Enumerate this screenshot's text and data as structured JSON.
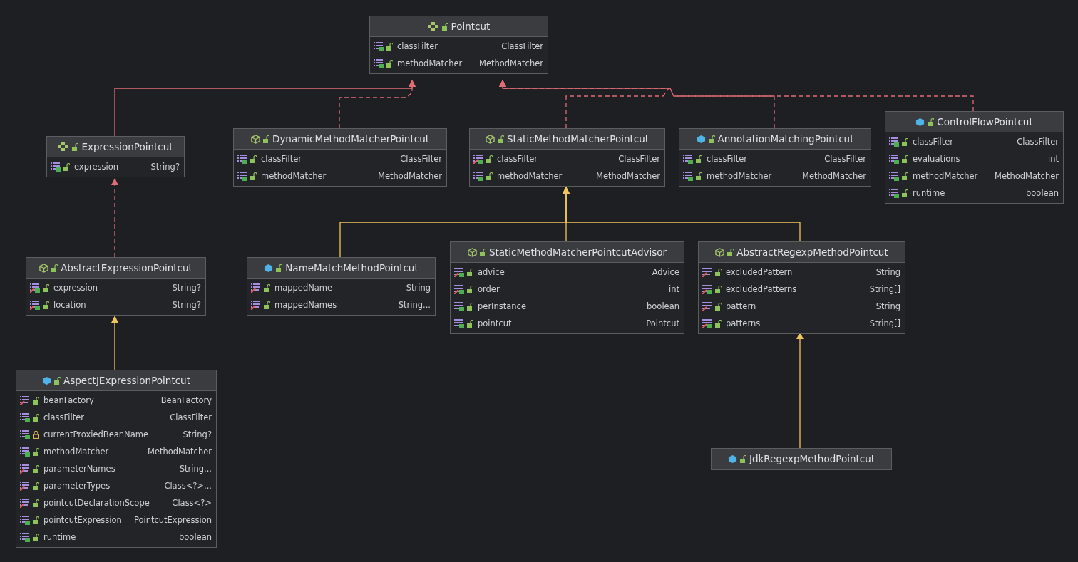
{
  "diagram": {
    "nodes": [
      {
        "name": "Pointcut",
        "kind": "interface",
        "fields": [
          {
            "name": "classFilter",
            "type": "ClassFilter",
            "readable": true,
            "writable": false,
            "private": false
          },
          {
            "name": "methodMatcher",
            "type": "MethodMatcher",
            "readable": true,
            "writable": false,
            "private": false
          }
        ]
      },
      {
        "name": "ExpressionPointcut",
        "kind": "interface",
        "fields": [
          {
            "name": "expression",
            "type": "String?",
            "readable": true,
            "writable": false,
            "private": false
          }
        ]
      },
      {
        "name": "DynamicMethodMatcherPointcut",
        "kind": "abstract",
        "fields": [
          {
            "name": "classFilter",
            "type": "ClassFilter",
            "readable": true,
            "writable": false,
            "private": false
          },
          {
            "name": "methodMatcher",
            "type": "MethodMatcher",
            "readable": true,
            "writable": false,
            "private": false
          }
        ]
      },
      {
        "name": "StaticMethodMatcherPointcut",
        "kind": "abstract",
        "fields": [
          {
            "name": "classFilter",
            "type": "ClassFilter",
            "readable": true,
            "writable": true,
            "private": false
          },
          {
            "name": "methodMatcher",
            "type": "MethodMatcher",
            "readable": true,
            "writable": false,
            "private": false
          }
        ]
      },
      {
        "name": "AnnotationMatchingPointcut",
        "kind": "class",
        "fields": [
          {
            "name": "classFilter",
            "type": "ClassFilter",
            "readable": true,
            "writable": false,
            "private": false
          },
          {
            "name": "methodMatcher",
            "type": "MethodMatcher",
            "readable": true,
            "writable": false,
            "private": false
          }
        ]
      },
      {
        "name": "ControlFlowPointcut",
        "kind": "class",
        "fields": [
          {
            "name": "classFilter",
            "type": "ClassFilter",
            "readable": true,
            "writable": false,
            "private": false
          },
          {
            "name": "evaluations",
            "type": "int",
            "readable": true,
            "writable": false,
            "private": false
          },
          {
            "name": "methodMatcher",
            "type": "MethodMatcher",
            "readable": true,
            "writable": false,
            "private": false
          },
          {
            "name": "runtime",
            "type": "boolean",
            "readable": true,
            "writable": false,
            "private": false
          }
        ]
      },
      {
        "name": "AbstractExpressionPointcut",
        "kind": "abstract",
        "fields": [
          {
            "name": "expression",
            "type": "String?",
            "readable": true,
            "writable": true,
            "private": false
          },
          {
            "name": "location",
            "type": "String?",
            "readable": true,
            "writable": true,
            "private": false
          }
        ]
      },
      {
        "name": "NameMatchMethodPointcut",
        "kind": "class",
        "fields": [
          {
            "name": "mappedName",
            "type": "String",
            "readable": false,
            "writable": true,
            "private": false
          },
          {
            "name": "mappedNames",
            "type": "String...",
            "readable": false,
            "writable": true,
            "private": false
          }
        ]
      },
      {
        "name": "StaticMethodMatcherPointcutAdvisor",
        "kind": "abstract",
        "fields": [
          {
            "name": "advice",
            "type": "Advice",
            "readable": true,
            "writable": true,
            "private": false
          },
          {
            "name": "order",
            "type": "int",
            "readable": true,
            "writable": true,
            "private": false
          },
          {
            "name": "perInstance",
            "type": "boolean",
            "readable": true,
            "writable": false,
            "private": false
          },
          {
            "name": "pointcut",
            "type": "Pointcut",
            "readable": true,
            "writable": false,
            "private": false
          }
        ]
      },
      {
        "name": "AbstractRegexpMethodPointcut",
        "kind": "abstract",
        "fields": [
          {
            "name": "excludedPattern",
            "type": "String",
            "readable": false,
            "writable": true,
            "private": false
          },
          {
            "name": "excludedPatterns",
            "type": "String[]",
            "readable": true,
            "writable": true,
            "private": false
          },
          {
            "name": "pattern",
            "type": "String",
            "readable": false,
            "writable": true,
            "private": false
          },
          {
            "name": "patterns",
            "type": "String[]",
            "readable": true,
            "writable": true,
            "private": false
          }
        ]
      },
      {
        "name": "AspectJExpressionPointcut",
        "kind": "class",
        "fields": [
          {
            "name": "beanFactory",
            "type": "BeanFactory",
            "readable": false,
            "writable": true,
            "private": false
          },
          {
            "name": "classFilter",
            "type": "ClassFilter",
            "readable": true,
            "writable": false,
            "private": false
          },
          {
            "name": "currentProxiedBeanName",
            "type": "String?",
            "readable": true,
            "writable": false,
            "private": true
          },
          {
            "name": "methodMatcher",
            "type": "MethodMatcher",
            "readable": true,
            "writable": false,
            "private": false
          },
          {
            "name": "parameterNames",
            "type": "String...",
            "readable": false,
            "writable": true,
            "private": false
          },
          {
            "name": "parameterTypes",
            "type": "Class<?>...",
            "readable": false,
            "writable": true,
            "private": false
          },
          {
            "name": "pointcutDeclarationScope",
            "type": "Class<?>",
            "readable": false,
            "writable": true,
            "private": false
          },
          {
            "name": "pointcutExpression",
            "type": "PointcutExpression",
            "readable": true,
            "writable": false,
            "private": false
          },
          {
            "name": "runtime",
            "type": "boolean",
            "readable": true,
            "writable": false,
            "private": false
          }
        ]
      },
      {
        "name": "JdkRegexpMethodPointcut",
        "kind": "class"
      }
    ],
    "links": [
      {
        "kind": "extends_interface"
      },
      {
        "kind": "implements"
      },
      {
        "kind": "implements"
      },
      {
        "kind": "implements"
      },
      {
        "kind": "implements"
      },
      {
        "kind": "implements"
      },
      {
        "kind": "extends"
      },
      {
        "kind": "extends"
      },
      {
        "kind": "extends"
      },
      {
        "kind": "extends"
      },
      {
        "kind": "extends"
      }
    ]
  }
}
